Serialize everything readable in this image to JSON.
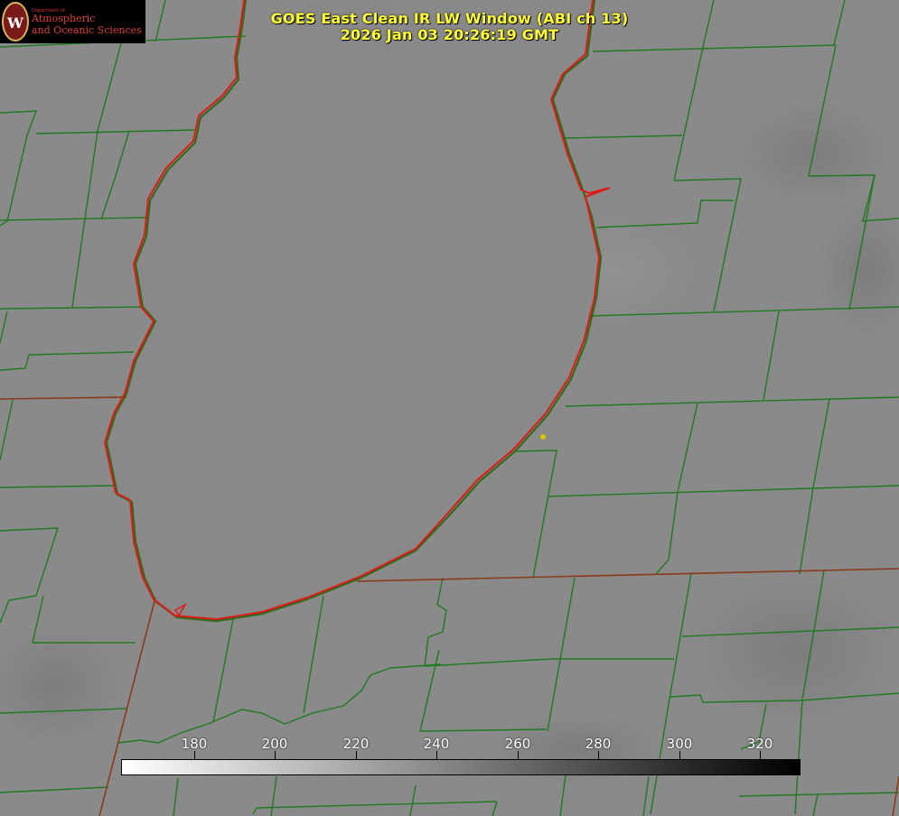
{
  "title": "GOES East Clean IR LW Window (ABI ch 13)",
  "timestamp": "2026 Jan 03 20:26:19 GMT",
  "logo": {
    "department": "Department of",
    "line1": "Atmospheric",
    "line2": "and Oceanic Sciences",
    "seal_letter": "W"
  },
  "colorbar": {
    "min": 162,
    "max": 330,
    "ticks": [
      "180",
      "200",
      "220",
      "240",
      "260",
      "280",
      "300",
      "320"
    ],
    "gradient_start": "#ffffff",
    "gradient_end": "#000000"
  },
  "colors": {
    "background": "#8a8a8a",
    "county_lines": "#1f7a1f",
    "coastline": "#e01818",
    "state_lines": "#8a3a1a",
    "title_text": "#ffff33",
    "marker": "#d8c400"
  },
  "map": {
    "features": [
      "lake-michigan-outline",
      "county-boundaries",
      "state-boundaries",
      "location-marker"
    ]
  }
}
